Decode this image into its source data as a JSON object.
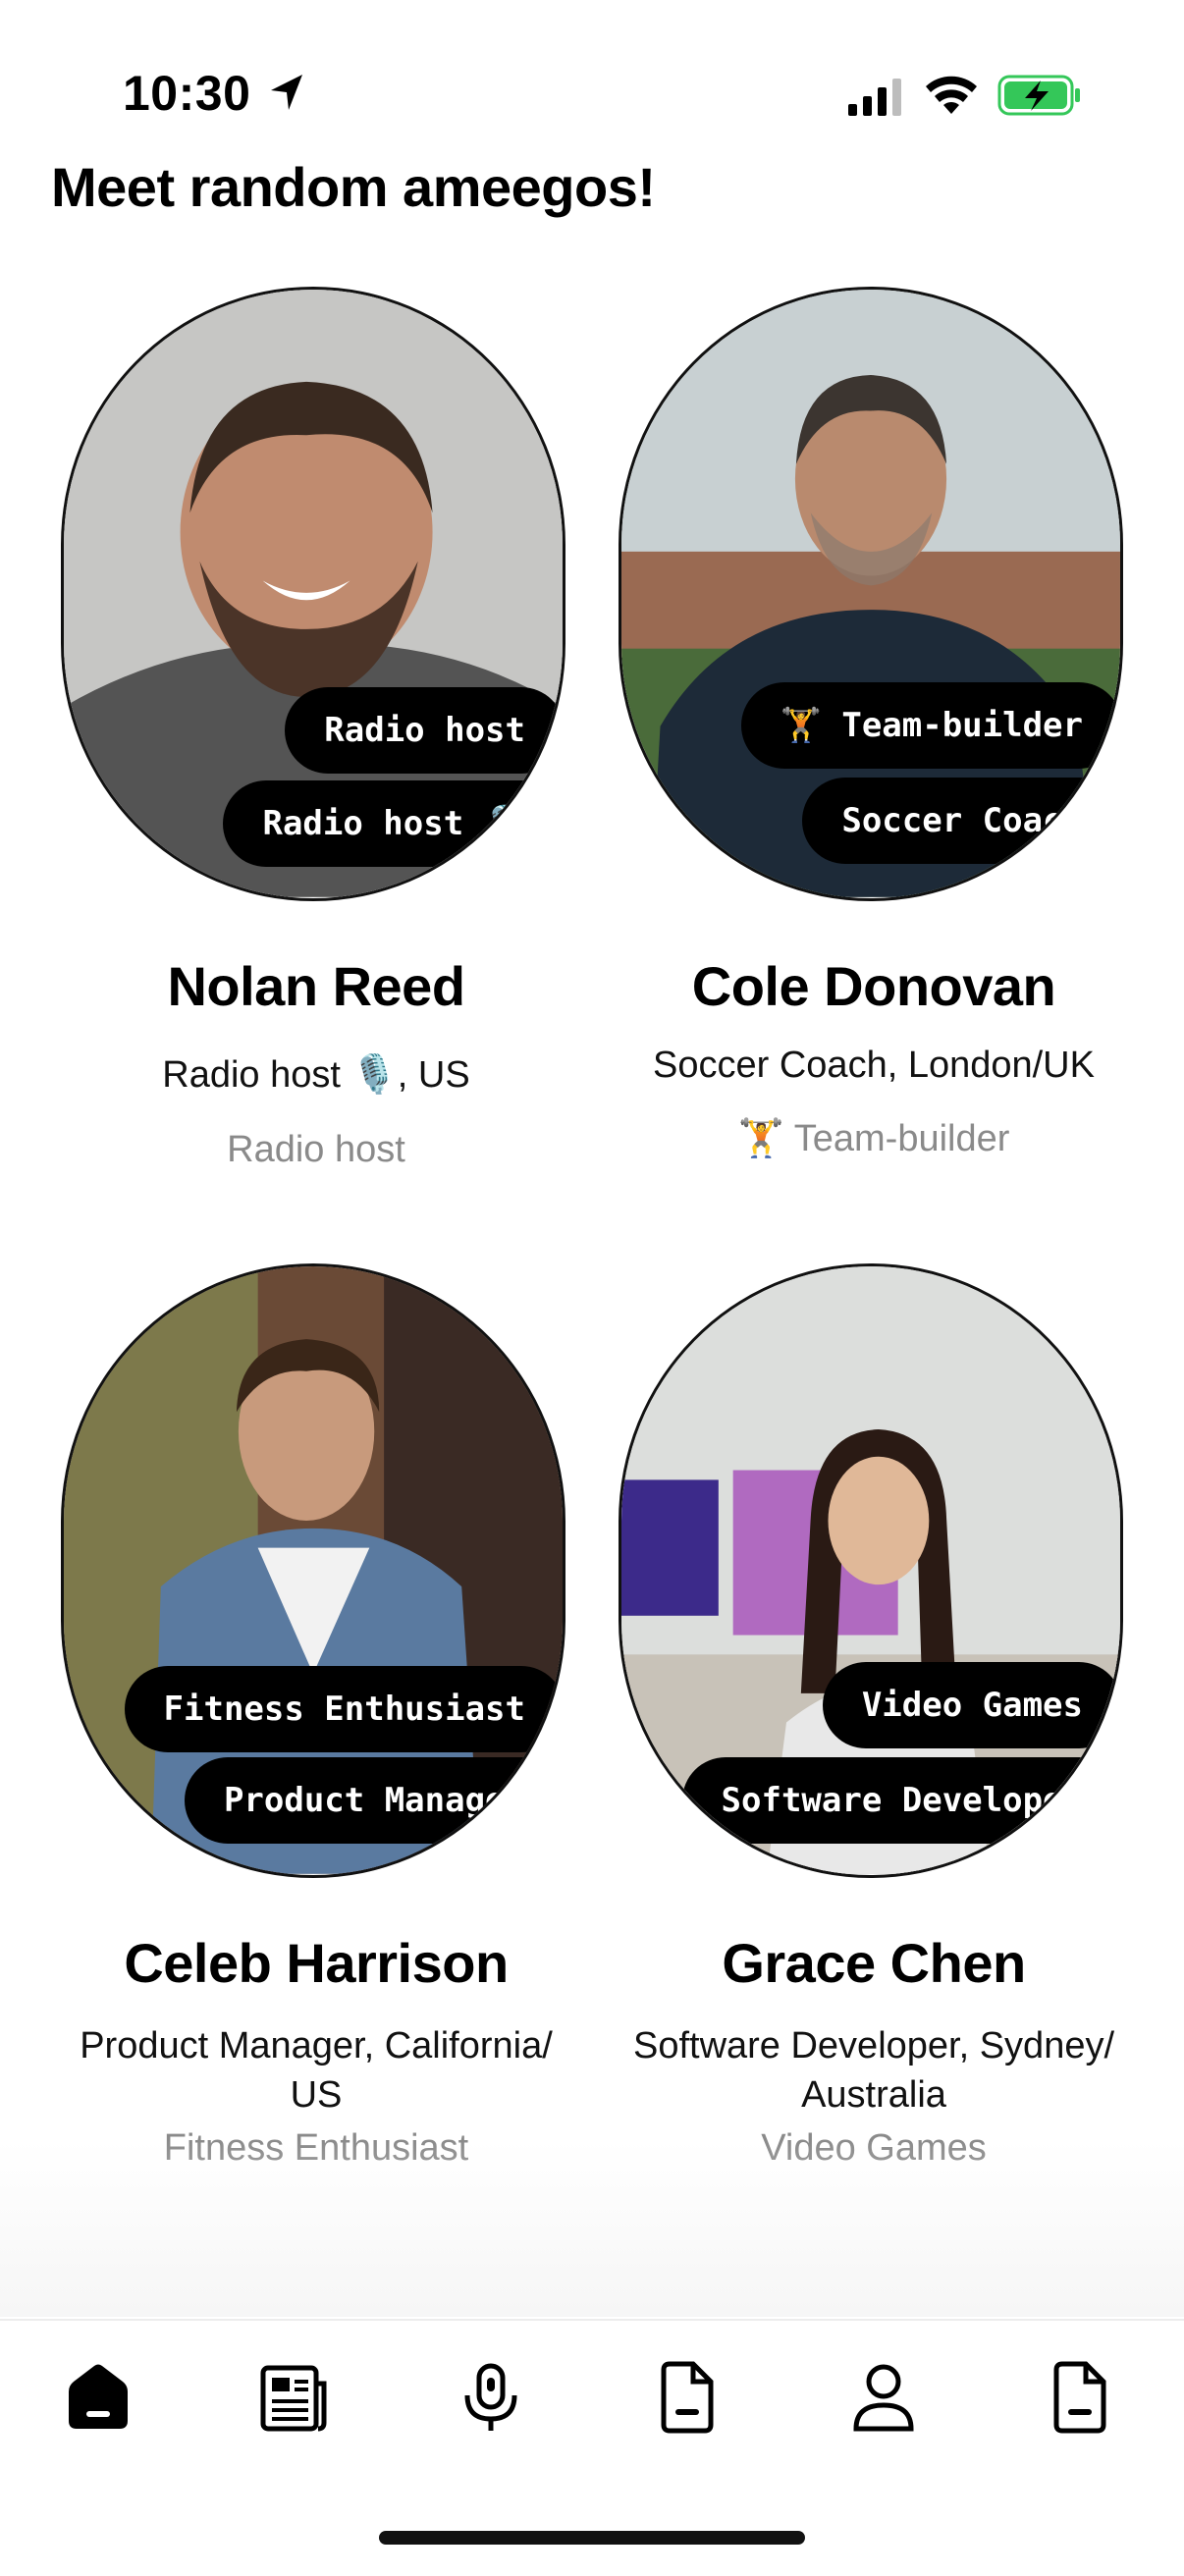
{
  "status": {
    "time": "10:30"
  },
  "header": {
    "title": "Meet random ameegos!"
  },
  "profiles": [
    {
      "name": "Nolan Reed",
      "subtitle": "Radio host 🎙️, US",
      "hobby": "Radio host",
      "tags": [
        "Radio host",
        "Radio host 🎙️"
      ]
    },
    {
      "name": "Cole Donovan",
      "subtitle": "Soccer Coach, London/UK",
      "hobby": "🏋️ Team-builder",
      "tags": [
        "🏋️ Team-builder",
        "Soccer Coach"
      ]
    },
    {
      "name": "Celeb Harrison",
      "subtitle": "Product Manager, California/ US",
      "hobby": "Fitness Enthusiast",
      "tags": [
        "Fitness Enthusiast",
        "Product Manager"
      ]
    },
    {
      "name": "Grace Chen",
      "subtitle": "Software Developer, Sydney/ Australia",
      "hobby": "Video Games",
      "tags": [
        "Video Games",
        "Software Developer"
      ]
    }
  ],
  "nav": {
    "items": [
      "home-icon",
      "newspaper-icon",
      "microphone-icon",
      "document-icon",
      "profile-icon",
      "document-icon"
    ]
  },
  "colors": {
    "battery_green": "#34c759",
    "secondary_text": "#8a8a8a"
  }
}
